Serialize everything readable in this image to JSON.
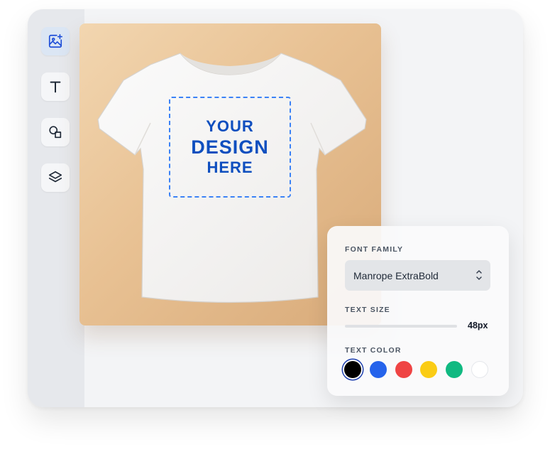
{
  "sidebar": {
    "tools": [
      {
        "name": "image-add",
        "active": true
      },
      {
        "name": "text",
        "active": false
      },
      {
        "name": "shapes",
        "active": false
      },
      {
        "name": "layers",
        "active": false
      }
    ]
  },
  "canvas": {
    "design_text": {
      "line1": "YOUR",
      "line2": "DESIGN",
      "line3": "HERE"
    }
  },
  "panel": {
    "font_family_label": "FONT FAMILY",
    "font_family_value": "Manrope ExtraBold",
    "text_size_label": "TEXT SIZE",
    "text_size_value": "48px",
    "text_color_label": "TEXT COLOR",
    "colors": [
      "#000000",
      "#2563eb",
      "#ef4444",
      "#facc15",
      "#10b981",
      "#ffffff"
    ],
    "selected_color": "#000000"
  },
  "colors": {
    "accent": "#3b82f6",
    "design_text": "#0f4fbf"
  }
}
